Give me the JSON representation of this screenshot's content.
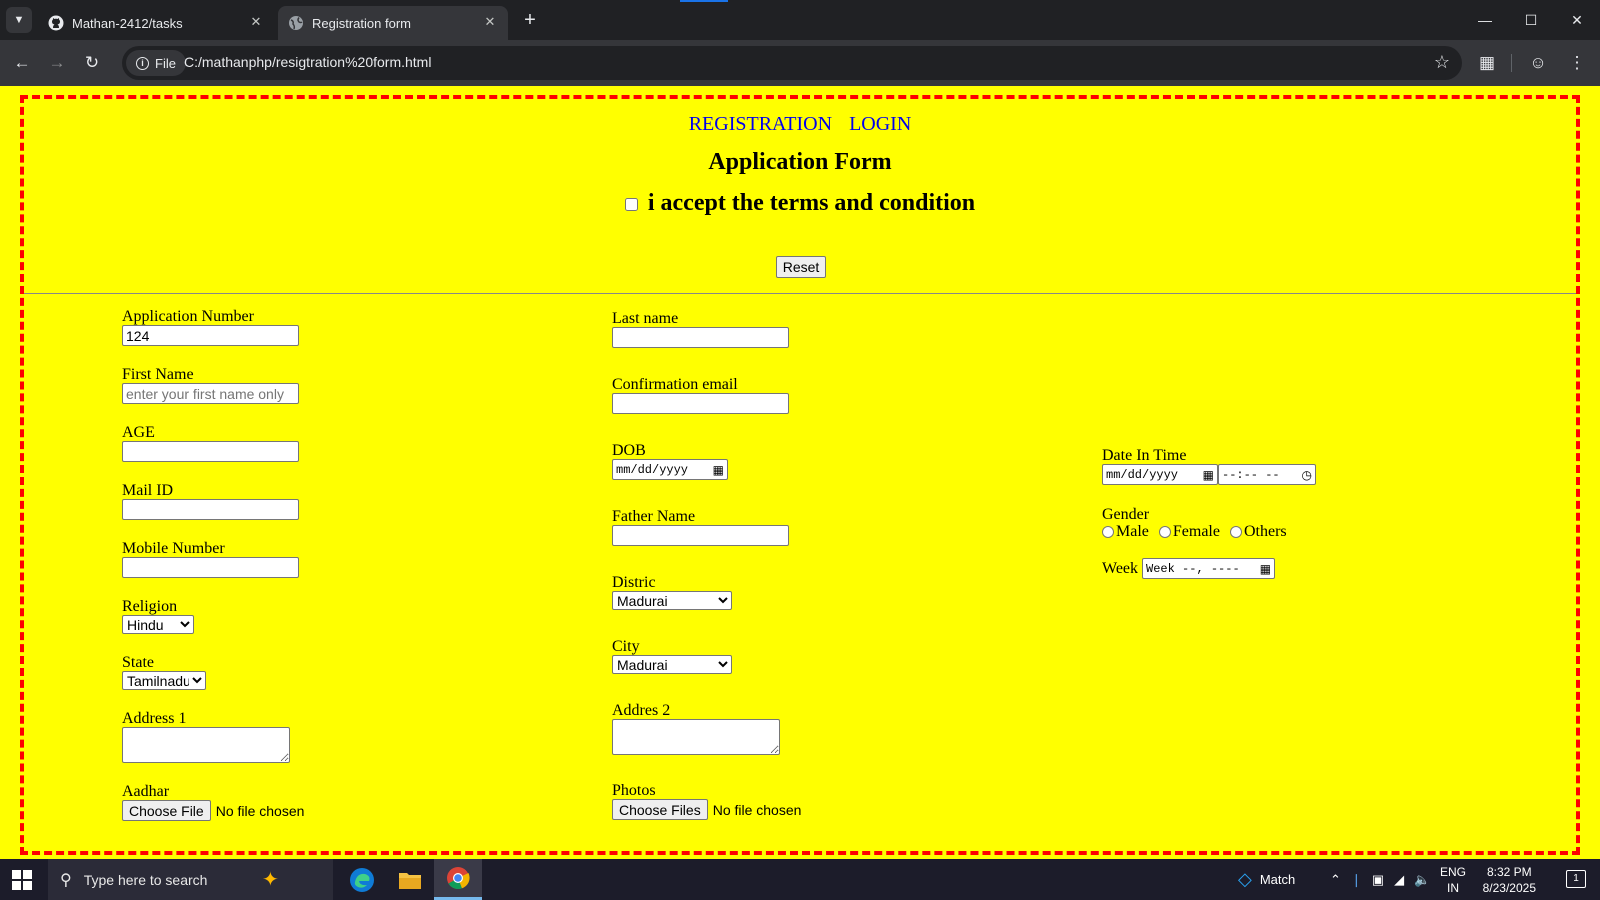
{
  "browser": {
    "tabs": [
      {
        "title": "Mathan-2412/tasks",
        "icon": "github-icon",
        "active": false
      },
      {
        "title": "Registration form",
        "icon": "globe-icon",
        "active": true
      }
    ],
    "site_chip": "File",
    "url": "C:/mathanphp/resigtration%20form.html"
  },
  "page": {
    "nav_links": [
      "REGISTRATION",
      "LOGIN"
    ],
    "title": "Application Form",
    "terms_label": "i accept the terms and condition",
    "reset_label": "Reset",
    "col1": {
      "app_number_label": "Application Number",
      "app_number_value": "124",
      "first_name_label": "First Name",
      "first_name_placeholder": "enter your first name only",
      "age_label": "AGE",
      "mail_label": "Mail ID",
      "mobile_label": "Mobile Number",
      "religion_label": "Religion",
      "religion_value": "Hindu",
      "state_label": "State",
      "state_value": "Tamilnadu",
      "address1_label": "Address 1",
      "aadhar_label": "Aadhar",
      "aadhar_button": "Choose File",
      "aadhar_status": "No file chosen"
    },
    "col2": {
      "last_name_label": "Last name",
      "confirm_email_label": "Confirmation email",
      "dob_label": "DOB",
      "dob_placeholder": "mm/dd/yyyy",
      "father_label": "Father Name",
      "district_label": "Distric",
      "district_value": "Madurai",
      "city_label": "City",
      "city_value": "Madurai",
      "address2_label": "Addres 2",
      "photos_label": "Photos",
      "photos_button": "Choose Files",
      "photos_status": "No file chosen"
    },
    "col3": {
      "datetime_label": "Date In Time",
      "date_placeholder": "mm/dd/yyyy",
      "time_placeholder": "--:-- --",
      "gender_label": "Gender",
      "gender_options": [
        "Male",
        "Female",
        "Others"
      ],
      "week_label": "Week",
      "week_placeholder": "Week --, ----"
    }
  },
  "taskbar": {
    "search_placeholder": "Type here to search",
    "weather_text": "Match",
    "lang_line1": "ENG",
    "lang_line2": "IN",
    "time": "8:32 PM",
    "date": "8/23/2025",
    "notification_count": "1"
  }
}
